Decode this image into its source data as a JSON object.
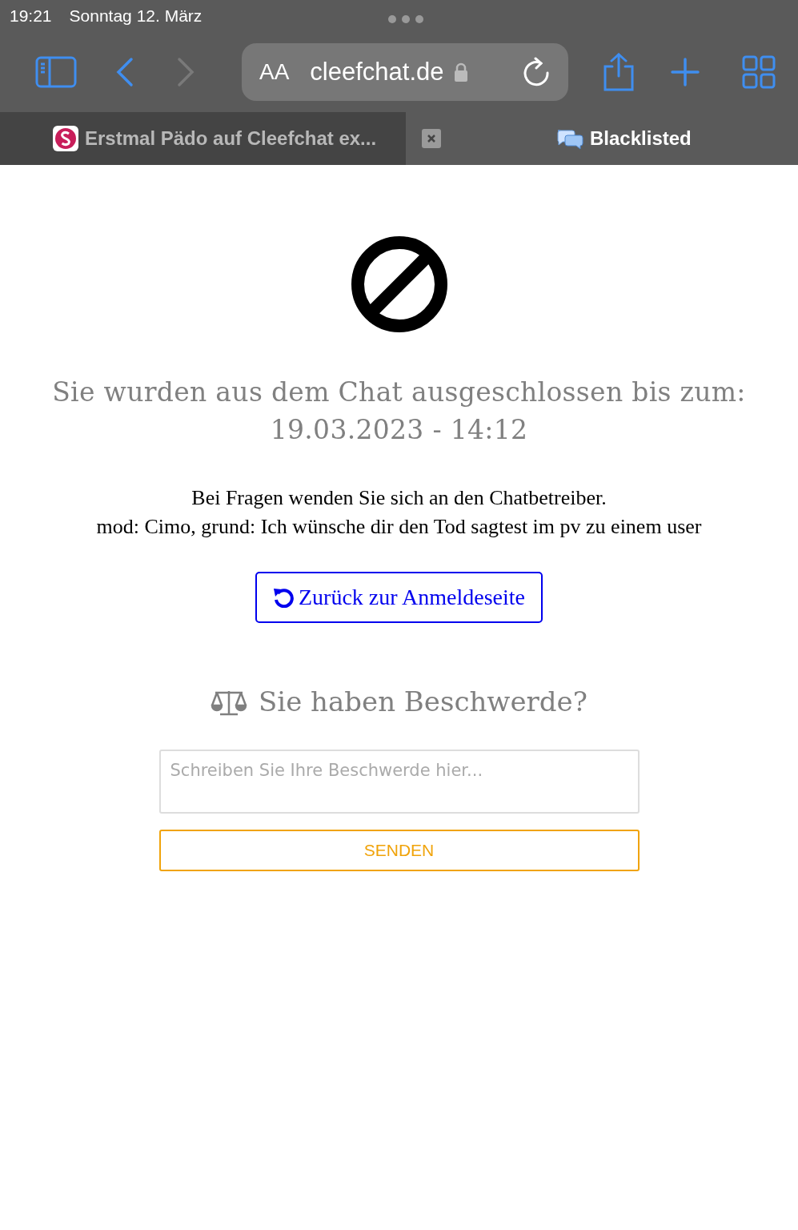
{
  "status_bar": {
    "time": "19:21",
    "date": "Sonntag 12. März"
  },
  "toolbar": {
    "text_size_label": "AA",
    "address": "cleefchat.de",
    "secure": true,
    "forward_disabled": true
  },
  "tabs": [
    {
      "title": "Erstmal Pädo auf Cleefchat ex...",
      "selected": false,
      "kind": "site"
    },
    {
      "title": "Blacklisted",
      "selected": true,
      "kind": "chat"
    }
  ],
  "page": {
    "ban_message": "Sie wurden aus dem Chat ausgeschlossen bis zum:",
    "ban_until": "19.03.2023 - 14:12",
    "info": "Bei Fragen wenden Sie sich an den Chatbetreiber.",
    "reason": "mod: Cimo, grund: Ich wünsche dir den Tod sagtest im pv zu einem user",
    "back_button": "Zurück zur Anmeldeseite",
    "complaint_heading": "Sie haben Beschwerde?",
    "complaint_placeholder": "Schreiben Sie Ihre Beschwerde hier...",
    "send_button": "SENDEN"
  }
}
